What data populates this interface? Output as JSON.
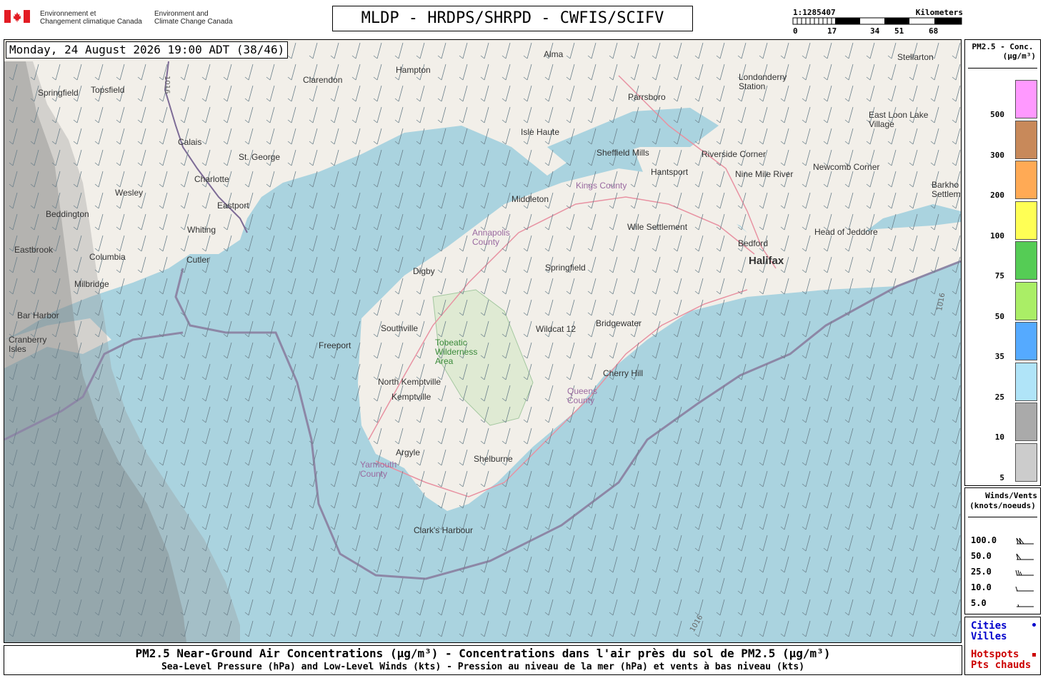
{
  "header": {
    "dept_fr": [
      "Environnement et",
      "Changement climatique Canada"
    ],
    "dept_en": [
      "Environment and",
      "Climate Change Canada"
    ],
    "title": "MLDP - HRDPS/SHRPD - CWFIS/SCIFV",
    "scale": {
      "ratio": "1:1285407",
      "unit": "Kilometers",
      "ticks": [
        "0",
        "17",
        "34",
        "51",
        "68"
      ]
    }
  },
  "map": {
    "timestamp": "Monday, 24 August 2026 19:00 ADT (38/46)",
    "places": [
      {
        "name": "Alma"
      },
      {
        "name": "Stellarton"
      },
      {
        "name": "Clarendon"
      },
      {
        "name": "Hampton"
      },
      {
        "name": "Londonderry Station"
      },
      {
        "name": "Springfield"
      },
      {
        "name": "Topsfield"
      },
      {
        "name": "Parrsboro"
      },
      {
        "name": "East Loon Lake Village"
      },
      {
        "name": "Isle Haute"
      },
      {
        "name": "Calais"
      },
      {
        "name": "St. George"
      },
      {
        "name": "Sheffield Mills"
      },
      {
        "name": "Riverside Corner"
      },
      {
        "name": "Newcomb Corner"
      },
      {
        "name": "Charlotte"
      },
      {
        "name": "Hantsport"
      },
      {
        "name": "Nine Mile River"
      },
      {
        "name": "Wesley"
      },
      {
        "name": "Kings County"
      },
      {
        "name": "Barkhouse Settlement"
      },
      {
        "name": "Eastport"
      },
      {
        "name": "Middleton"
      },
      {
        "name": "Beddington"
      },
      {
        "name": "Whiting"
      },
      {
        "name": "Wile Settlement"
      },
      {
        "name": "Head of Jeddore"
      },
      {
        "name": "Annapolis County"
      },
      {
        "name": "Bedford"
      },
      {
        "name": "Eastbrook"
      },
      {
        "name": "Halifax"
      },
      {
        "name": "Columbia"
      },
      {
        "name": "Cutler"
      },
      {
        "name": "Springfield"
      },
      {
        "name": "Digby"
      },
      {
        "name": "Milbridge"
      },
      {
        "name": "Bar Harbor"
      },
      {
        "name": "Southville"
      },
      {
        "name": "Wildcat 12"
      },
      {
        "name": "Bridgewater"
      },
      {
        "name": "Cranberry Isles"
      },
      {
        "name": "Freeport"
      },
      {
        "name": "Tobeatic Wilderness Area"
      },
      {
        "name": "Cherry Hill"
      },
      {
        "name": "North Kemptville"
      },
      {
        "name": "Kemptville"
      },
      {
        "name": "Queens County"
      },
      {
        "name": "Argyle"
      },
      {
        "name": "Yarmouth County"
      },
      {
        "name": "Shelburne"
      },
      {
        "name": "Clark's Harbour"
      }
    ],
    "isobar_labels": [
      "1016",
      "1016",
      "1016"
    ]
  },
  "pm_legend": {
    "title": "PM2.5 - Conc.",
    "unit": "(µg/m³)",
    "bins": [
      {
        "label": "500",
        "color": "#ff99ff"
      },
      {
        "label": "300",
        "color": "#c8895a"
      },
      {
        "label": "200",
        "color": "#ffaa55"
      },
      {
        "label": "100",
        "color": "#ffff55"
      },
      {
        "label": "75",
        "color": "#55cc55"
      },
      {
        "label": "50",
        "color": "#aaee66"
      },
      {
        "label": "35",
        "color": "#55aaff"
      },
      {
        "label": "25",
        "color": "#b0e4f8"
      },
      {
        "label": "10",
        "color": "#aaaaaa"
      },
      {
        "label": "5",
        "color": "#cccccc"
      }
    ]
  },
  "wind_legend": {
    "title": "Winds/Vents",
    "unit": "(knots/noeuds)",
    "rows": [
      "100.0",
      "50.0",
      "25.0",
      "10.0",
      "5.0"
    ]
  },
  "city_legend": {
    "cities": "Cities",
    "villes": "Villes",
    "hotspots": "Hotspots",
    "pts_chauds": "Pts chauds",
    "city_color": "#0000cc",
    "hotspot_color": "#cc0000"
  },
  "footer": {
    "line1": "PM2.5 Near-Ground Air Concentrations (µg/m³) - Concentrations dans l'air près du sol de PM2.5 (µg/m³)",
    "line2": "Sea-Level Pressure (hPa) and Low-Level Winds (kts) - Pression au niveau de la mer (hPa) et vents à bas niveau (kts)"
  }
}
